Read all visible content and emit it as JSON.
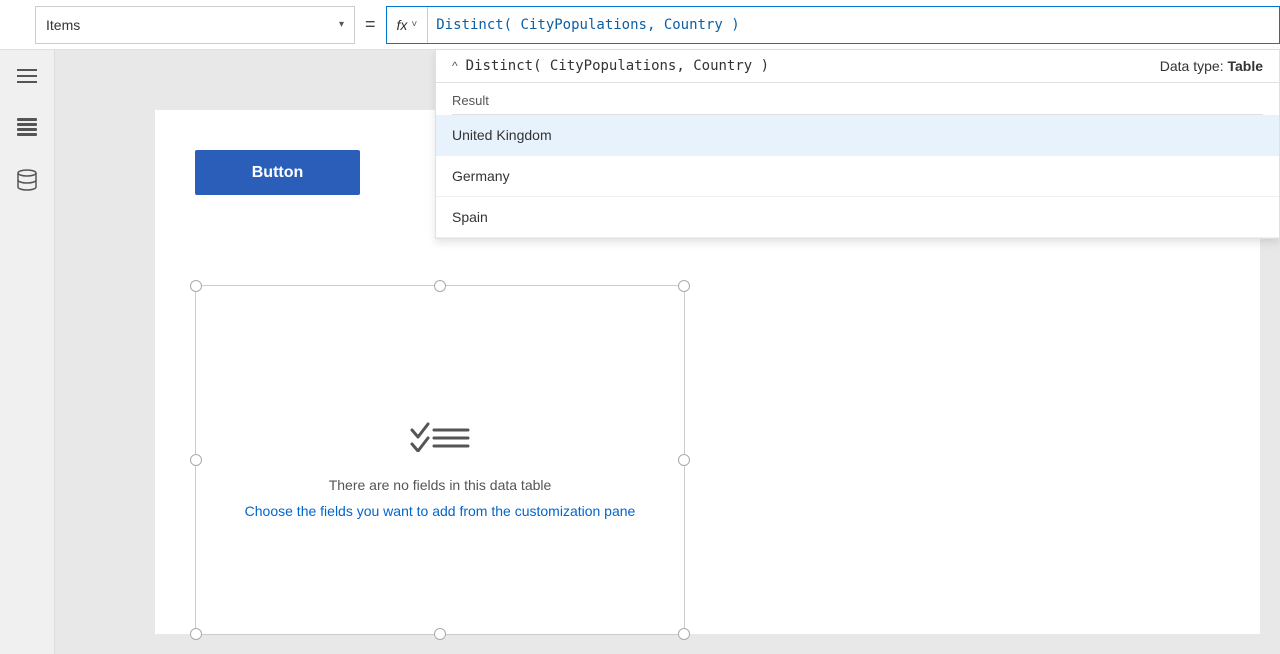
{
  "topbar": {
    "items_label": "Items",
    "items_chevron": "▾",
    "equals": "=",
    "fx_label": "fx",
    "fx_chevron": "˅",
    "formula_value": "Distinct( CityPopulations, Country )"
  },
  "autocomplete": {
    "chevron": "^",
    "formula": "Distinct( CityPopulations, Country )",
    "data_type_prefix": "Data type: ",
    "data_type_value": "Table",
    "section_header": "Result",
    "items": [
      {
        "label": "United Kingdom"
      },
      {
        "label": "Germany"
      },
      {
        "label": "Spain"
      }
    ]
  },
  "sidebar": {
    "icons": [
      {
        "name": "menu-icon",
        "glyph": "☰"
      },
      {
        "name": "layers-icon",
        "glyph": "⊡"
      },
      {
        "name": "database-icon",
        "glyph": "🗄"
      }
    ]
  },
  "canvas": {
    "button_label": "Button",
    "empty_state_text": "There are no fields in this data table",
    "empty_state_link": "Choose the fields you want to add from the customization pane"
  }
}
